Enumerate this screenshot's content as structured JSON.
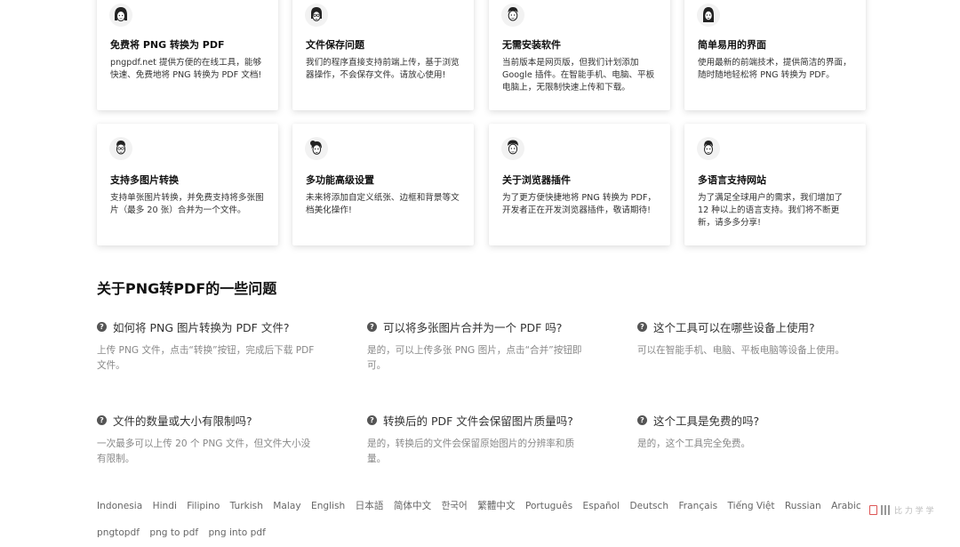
{
  "cards": [
    {
      "title": "免费将 PNG 转换为 PDF",
      "desc": "pngpdf.net 提供方便的在线工具，能够快速、免费地将 PNG 转换为 PDF 文档!",
      "icon": "woman-avatar-icon"
    },
    {
      "title": "文件保存问题",
      "desc": "我们的程序直接支持前端上传，基于浏览器操作，不会保存文件。请放心使用!",
      "icon": "woman-glasses-avatar-icon"
    },
    {
      "title": "无需安装软件",
      "desc": "当前版本是网页版，但我们计划添加 Google 插件。在智能手机、电脑、平板电脑上，无限制快速上传和下载。",
      "icon": "man-avatar-icon"
    },
    {
      "title": "简单易用的界面",
      "desc": "使用最新的前端技术，提供简洁的界面，随时随地轻松将 PNG 转换为 PDF。",
      "icon": "woman-longhair-avatar-icon"
    },
    {
      "title": "支持多图片转换",
      "desc": "支持单张图片转换，并免费支持将多张图片（最多 20 张）合并为一个文件。",
      "icon": "man-glasses-avatar-icon"
    },
    {
      "title": "多功能高级设置",
      "desc": "未来将添加自定义纸张、边框和背景等文档美化操作!",
      "icon": "woman-bun-avatar-icon"
    },
    {
      "title": "关于浏览器插件",
      "desc": "为了更方便快捷地将 PNG 转换为 PDF，开发者正在开发浏览器插件，敬请期待!",
      "icon": "man-curly-avatar-icon"
    },
    {
      "title": "多语言支持网站",
      "desc": "为了满足全球用户的需求，我们增加了 12 种以上的语言支持。我们将不断更新，请多多分享!",
      "icon": "man-short-avatar-icon"
    }
  ],
  "faq": {
    "heading": "关于PNG转PDF的一些问题",
    "items": [
      {
        "q": "如何将 PNG 图片转换为 PDF 文件?",
        "a": "上传 PNG 文件，点击“转换”按钮，完成后下载 PDF 文件。"
      },
      {
        "q": "可以将多张图片合并为一个 PDF 吗?",
        "a": "是的，可以上传多张 PNG 图片，点击“合并”按钮即可。"
      },
      {
        "q": "这个工具可以在哪些设备上使用?",
        "a": "可以在智能手机、电脑、平板电脑等设备上使用。"
      },
      {
        "q": "文件的数量或大小有限制吗?",
        "a": "一次最多可以上传 20 个 PNG 文件，但文件大小没有限制。"
      },
      {
        "q": "转换后的 PDF 文件会保留图片质量吗?",
        "a": "是的，转换后的文件会保留原始图片的分辨率和质量。"
      },
      {
        "q": "这个工具是免费的吗?",
        "a": "是的，这个工具完全免费。"
      }
    ]
  },
  "languages": [
    "Indonesia",
    "Hindi",
    "Filipino",
    "Turkish",
    "Malay",
    "English",
    "日本語",
    "简体中文",
    "한국어",
    "繁體中文",
    "Português",
    "Español",
    "Deutsch",
    "Français",
    "Tiếng Việt",
    "Russian",
    "Arabic"
  ],
  "footer_links": [
    "pngtopdf",
    "png to pdf",
    "png into pdf"
  ],
  "corner_text": "比 力 学 学"
}
